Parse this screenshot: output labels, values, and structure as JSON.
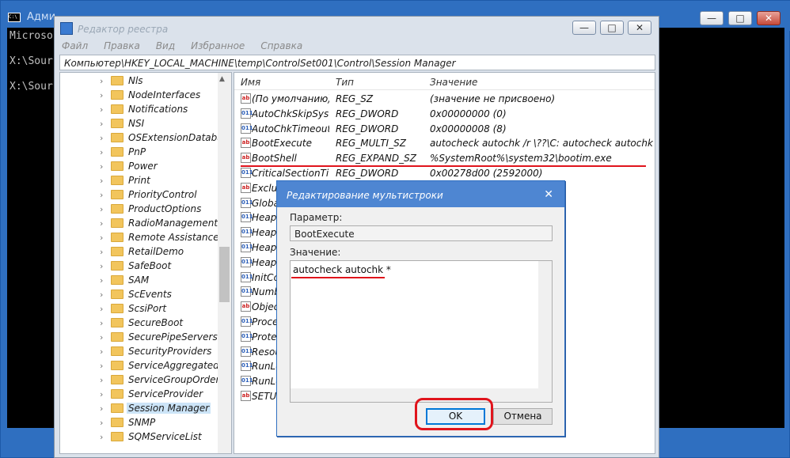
{
  "cmd": {
    "title": "Адми",
    "icon": "console-icon",
    "controls": [
      "—",
      "□",
      "✕"
    ],
    "lines": [
      "Microso",
      "",
      "X:\\Sour",
      "",
      "X:\\Sour"
    ]
  },
  "registry": {
    "title": "Редактор реестра",
    "icon": "regedit-icon",
    "controls": [
      "—",
      "□",
      "✕"
    ],
    "menu": [
      "Файл",
      "Правка",
      "Вид",
      "Избранное",
      "Справка"
    ],
    "address": "Компьютер\\HKEY_LOCAL_MACHINE\\temp\\ControlSet001\\Control\\Session Manager",
    "tree": [
      {
        "label": "Nls"
      },
      {
        "label": "NodeInterfaces"
      },
      {
        "label": "Notifications"
      },
      {
        "label": "NSI"
      },
      {
        "label": "OSExtensionDatabase"
      },
      {
        "label": "PnP"
      },
      {
        "label": "Power"
      },
      {
        "label": "Print"
      },
      {
        "label": "PriorityControl"
      },
      {
        "label": "ProductOptions"
      },
      {
        "label": "RadioManagement"
      },
      {
        "label": "Remote Assistance"
      },
      {
        "label": "RetailDemo"
      },
      {
        "label": "SafeBoot"
      },
      {
        "label": "SAM"
      },
      {
        "label": "ScEvents"
      },
      {
        "label": "ScsiPort"
      },
      {
        "label": "SecureBoot"
      },
      {
        "label": "SecurePipeServers"
      },
      {
        "label": "SecurityProviders"
      },
      {
        "label": "ServiceAggregatedEv"
      },
      {
        "label": "ServiceGroupOrder"
      },
      {
        "label": "ServiceProvider"
      },
      {
        "label": "Session Manager",
        "selected": true
      },
      {
        "label": "SNMP"
      },
      {
        "label": "SQMServiceList"
      }
    ],
    "columns": [
      "Имя",
      "Тип",
      "Значение"
    ],
    "values": [
      {
        "name": "(По умолчанию)",
        "type": "REG_SZ",
        "data": "(значение не присвоено)",
        "icon": "ab"
      },
      {
        "name": "AutoChkSkipSys...",
        "type": "REG_DWORD",
        "data": "0x00000000 (0)",
        "icon": "bin"
      },
      {
        "name": "AutoChkTimeout",
        "type": "REG_DWORD",
        "data": "0x00000008 (8)",
        "icon": "bin"
      },
      {
        "name": "BootExecute",
        "type": "REG_MULTI_SZ",
        "data": "autocheck autochk /r \\??\\C: autocheck autochk *",
        "icon": "ab"
      },
      {
        "name": "BootShell",
        "type": "REG_EXPAND_SZ",
        "data": "%SystemRoot%\\system32\\bootim.exe",
        "icon": "ab"
      },
      {
        "name": "CriticalSectionTi...",
        "type": "REG_DWORD",
        "data": "0x00278d00 (2592000)",
        "icon": "bin"
      },
      {
        "name": "Exclud",
        "type": "",
        "data": "",
        "icon": "ab"
      },
      {
        "name": "Globa",
        "type": "",
        "data": "",
        "icon": "bin"
      },
      {
        "name": "HeapI",
        "type": "",
        "data": "",
        "icon": "bin"
      },
      {
        "name": "HeapI",
        "type": "",
        "data": "",
        "icon": "bin"
      },
      {
        "name": "HeapS",
        "type": "",
        "data": "",
        "icon": "bin"
      },
      {
        "name": "HeapS",
        "type": "",
        "data": "",
        "icon": "bin"
      },
      {
        "name": "InitCo",
        "type": "",
        "data": "",
        "icon": "bin"
      },
      {
        "name": "Numb",
        "type": "",
        "data": "",
        "icon": "bin"
      },
      {
        "name": "Object",
        "type": "",
        "data": "",
        "icon": "ab"
      },
      {
        "name": "Proces",
        "type": "",
        "data": "",
        "icon": "bin"
      },
      {
        "name": "Protec",
        "type": "",
        "data": "",
        "icon": "bin"
      },
      {
        "name": "Resou",
        "type": "",
        "data": "",
        "icon": "bin"
      },
      {
        "name": "RunLe",
        "type": "",
        "data": "",
        "icon": "bin"
      },
      {
        "name": "RunLe",
        "type": "",
        "data": "",
        "icon": "bin"
      },
      {
        "name": "SETUP",
        "type": "",
        "data": "",
        "icon": "ab"
      }
    ]
  },
  "dialog": {
    "title": "Редактирование мультистроки",
    "close": "✕",
    "param_label": "Параметр:",
    "param_value": "BootExecute",
    "value_label": "Значение:",
    "value_text": "autocheck autochk *",
    "ok": "OK",
    "cancel": "Отмена"
  },
  "annotations": {
    "color": "#e0141c"
  }
}
